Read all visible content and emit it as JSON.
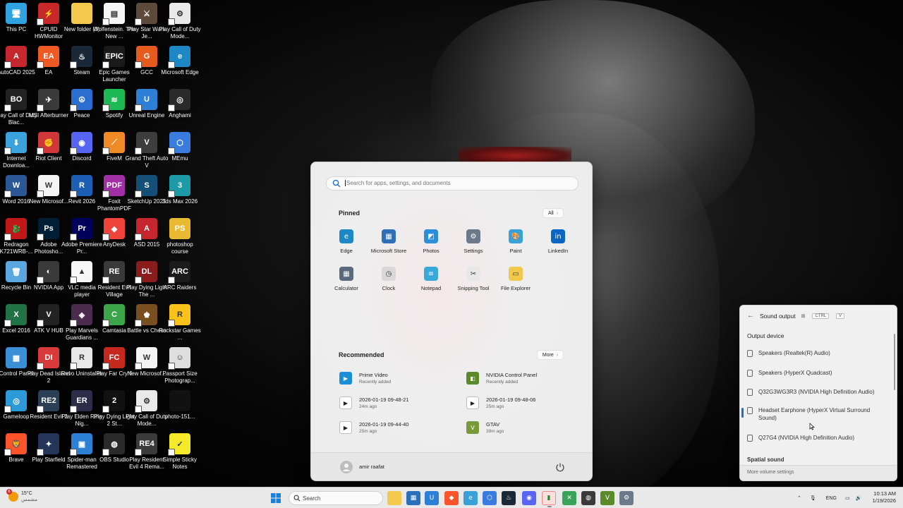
{
  "desktop": {
    "icons": [
      {
        "label": "This PC",
        "color": "#2ea3e0",
        "glyph": "🖥",
        "noarrow": true
      },
      {
        "label": "CPUID HWMonitor",
        "color": "#c62828",
        "glyph": "⚡"
      },
      {
        "label": "New folder (3)",
        "color": "#f2c94c",
        "glyph": "",
        "noarrow": true
      },
      {
        "label": "Wolfenstein. The New ...",
        "color": "#f5f5f5",
        "glyph": "▤"
      },
      {
        "label": "Play Star Wars Je...",
        "color": "#5d4a3a",
        "glyph": "⚔"
      },
      {
        "label": "Play Call of Duty Mode...",
        "color": "#e9e9e9",
        "glyph": "⚙"
      },
      {
        "label": "AutoCAD 2025",
        "color": "#c6262e",
        "glyph": "A"
      },
      {
        "label": "EA",
        "color": "#ef5a24",
        "glyph": "EA"
      },
      {
        "label": "Steam",
        "color": "#1b2838",
        "glyph": "♨"
      },
      {
        "label": "Epic Games Launcher",
        "color": "#1a1a1a",
        "glyph": "EPIC"
      },
      {
        "label": "GCC",
        "color": "#e65a1e",
        "glyph": "G"
      },
      {
        "label": "Microsoft Edge",
        "color": "#1e88c7",
        "glyph": "e"
      },
      {
        "label": "Play Call of Duty Blac...",
        "color": "#222",
        "glyph": "BO"
      },
      {
        "label": "MSI Afterburner",
        "color": "#3a3a3a",
        "glyph": "✈"
      },
      {
        "label": "Peace",
        "color": "#2a6fd0",
        "glyph": "☮"
      },
      {
        "label": "Spotify",
        "color": "#1db954",
        "glyph": "≋"
      },
      {
        "label": "Unreal Engine",
        "color": "#2e7fd6",
        "glyph": "U"
      },
      {
        "label": "Anghami",
        "color": "#2a2a2a",
        "glyph": "◎"
      },
      {
        "label": "Internet Downloa...",
        "color": "#3aa3de",
        "glyph": "⬇"
      },
      {
        "label": "Riot Client",
        "color": "#d13639",
        "glyph": "✊"
      },
      {
        "label": "Discord",
        "color": "#5865f2",
        "glyph": "◉"
      },
      {
        "label": "FiveM",
        "color": "#f08a24",
        "glyph": "⟋"
      },
      {
        "label": "Grand Theft Auto V",
        "color": "#3d3d3d",
        "glyph": "V"
      },
      {
        "label": "MEmu",
        "color": "#3a7be0",
        "glyph": "⬡"
      },
      {
        "label": "Word 2016",
        "color": "#2b5797",
        "glyph": "W"
      },
      {
        "label": "New Microsof...",
        "color": "#f4f4f4",
        "glyph": "W"
      },
      {
        "label": "Revit 2026",
        "color": "#1d5fb4",
        "glyph": "R"
      },
      {
        "label": "Foxit PhantomPDF",
        "color": "#a12fa5",
        "glyph": "PDF"
      },
      {
        "label": "SketchUp 2025",
        "color": "#134f77",
        "glyph": "S"
      },
      {
        "label": "3ds Max 2026",
        "color": "#1e9aa6",
        "glyph": "3"
      },
      {
        "label": "Redragon K721WRB-...",
        "color": "#c01818",
        "glyph": "🐉"
      },
      {
        "label": "Adobe Photosho...",
        "color": "#001e36",
        "glyph": "Ps"
      },
      {
        "label": "Adobe Premiere Pr...",
        "color": "#00005b",
        "glyph": "Pr"
      },
      {
        "label": "AnyDesk",
        "color": "#ef443b",
        "glyph": "◆"
      },
      {
        "label": "ASD 2015",
        "color": "#c6262e",
        "glyph": "A"
      },
      {
        "label": "photoshop course",
        "color": "#e8b931",
        "glyph": "PS",
        "noarrow": true
      },
      {
        "label": "Recycle Bin",
        "color": "#5aa6e0",
        "glyph": "🗑",
        "noarrow": true
      },
      {
        "label": "NVIDIA App",
        "color": "#3a3a3a",
        "glyph": "◐"
      },
      {
        "label": "VLC media player",
        "color": "#f6f6f6",
        "glyph": "▲"
      },
      {
        "label": "Resident Evil Village",
        "color": "#3a3a3a",
        "glyph": "RE"
      },
      {
        "label": "Play Dying Light The ...",
        "color": "#8a1c1c",
        "glyph": "DL"
      },
      {
        "label": "ARC Raiders",
        "color": "#1b1b1b",
        "glyph": "ARC"
      },
      {
        "label": "Excel 2016",
        "color": "#217346",
        "glyph": "X"
      },
      {
        "label": "ATK V HUB",
        "color": "#222",
        "glyph": "V"
      },
      {
        "label": "Play Marvels Guardians ...",
        "color": "#4b2c4f",
        "glyph": "◈"
      },
      {
        "label": "Camtasia",
        "color": "#3ca54a",
        "glyph": "C"
      },
      {
        "label": "Battle vs Chess",
        "color": "#7a4f1e",
        "glyph": "♚"
      },
      {
        "label": "Rockstar Games ...",
        "color": "#f9c21b",
        "glyph": "R"
      },
      {
        "label": "Control Panel",
        "color": "#3a8fd6",
        "glyph": "▦",
        "noarrow": true
      },
      {
        "label": "Play Dead Island 2",
        "color": "#d83a3a",
        "glyph": "DI"
      },
      {
        "label": "Revo Uninstaller",
        "color": "#e8e8e8",
        "glyph": "R"
      },
      {
        "label": "Play Far Cry 6",
        "color": "#c4281f",
        "glyph": "FC"
      },
      {
        "label": "New Microsof...",
        "color": "#f4f4f4",
        "glyph": "W"
      },
      {
        "label": "Passport Size Photograp...",
        "color": "#dedede",
        "glyph": "☺"
      },
      {
        "label": "Gameloop",
        "color": "#2c9ad8",
        "glyph": "◎"
      },
      {
        "label": "Resident Evil 2",
        "color": "#2b3f57",
        "glyph": "RE2"
      },
      {
        "label": "Play Elden Ring Nig...",
        "color": "#2d2d4a",
        "glyph": "ER"
      },
      {
        "label": "Play Dying Light 2 St...",
        "color": "#111",
        "glyph": "2"
      },
      {
        "label": "Play Call of Duty Mode...",
        "color": "#e9e9e9",
        "glyph": "⚙"
      },
      {
        "label": "photo-151...",
        "color": "#111",
        "glyph": "",
        "noarrow": true
      },
      {
        "label": "Brave",
        "color": "#fb542b",
        "glyph": "🦁"
      },
      {
        "label": "Play Starfield",
        "color": "#24355a",
        "glyph": "✦"
      },
      {
        "label": "Spider-man Remastered",
        "color": "#2e7fd6",
        "glyph": "▣"
      },
      {
        "label": "OBS Studio",
        "color": "#2a2a2a",
        "glyph": "◍"
      },
      {
        "label": "Play Resident Evil 4 Rema...",
        "color": "#3a3a3a",
        "glyph": "RE4"
      },
      {
        "label": "Simple Sticky Notes",
        "color": "#f4ea2a",
        "glyph": "✓"
      }
    ]
  },
  "start_menu": {
    "search_placeholder": "Search for apps, settings, and documents",
    "pinned_title": "Pinned",
    "all_label": "All",
    "pinned": [
      {
        "label": "Edge",
        "color": "#1e88c7",
        "glyph": "e"
      },
      {
        "label": "Microsoft Store",
        "color": "#2f6fb8",
        "glyph": "▦"
      },
      {
        "label": "Photos",
        "color": "#2a8fd8",
        "glyph": "◩"
      },
      {
        "label": "Settings",
        "color": "#6b7a8a",
        "glyph": "⚙"
      },
      {
        "label": "Paint",
        "color": "#3aa0d8",
        "glyph": "🎨"
      },
      {
        "label": "LinkedIn",
        "color": "#0a66c2",
        "glyph": "in"
      },
      {
        "label": "Calculator",
        "color": "#5a6a7a",
        "glyph": "▦"
      },
      {
        "label": "Clock",
        "color": "#d8d8d8",
        "glyph": "◷"
      },
      {
        "label": "Notepad",
        "color": "#3aa8d8",
        "glyph": "≡"
      },
      {
        "label": "Snipping Tool",
        "color": "#e8e8e8",
        "glyph": "✂"
      },
      {
        "label": "File Explorer",
        "color": "#f2c94c",
        "glyph": "▭"
      }
    ],
    "recommended_title": "Recommended",
    "more_label": "More",
    "recommended": [
      {
        "title": "Prime Video",
        "sub": "Recently added",
        "color": "#1a8fd6",
        "glyph": "▶"
      },
      {
        "title": "NVIDIA Control Panel",
        "sub": "Recently added",
        "color": "#5a8a2a",
        "glyph": "◧"
      },
      {
        "title": "2026-01-19 09-48-21",
        "sub": "24m ago",
        "color": "#fff",
        "glyph": "▶"
      },
      {
        "title": "2026-01-19 09-48-06",
        "sub": "25m ago",
        "color": "#fff",
        "glyph": "▶"
      },
      {
        "title": "2026-01-19 09-44-40",
        "sub": "25m ago",
        "color": "#fff",
        "glyph": "▶"
      },
      {
        "title": "GTAV",
        "sub": "39m ago",
        "color": "#7a9a3a",
        "glyph": "V"
      }
    ],
    "user_name": "amir raafat"
  },
  "sound_output": {
    "title": "Sound output",
    "shortcut_keys": [
      "CTRL",
      "V"
    ],
    "section_title": "Output device",
    "devices": [
      {
        "label": "Speakers (Realtek(R) Audio)",
        "active": false
      },
      {
        "label": "Speakers (HyperX Quadcast)",
        "active": false
      },
      {
        "label": "Q32G3WG3R3 (NVIDIA High Definition Audio)",
        "active": false
      },
      {
        "label": "Headset Earphone (HyperX Virtual Surround Sound)",
        "active": true
      },
      {
        "label": "Q27G4 (NVIDIA High Definition Audio)",
        "active": false
      }
    ],
    "spatial_title": "Spatial sound",
    "more_settings": "More volume settings"
  },
  "taskbar": {
    "weather_temp": "15°C",
    "weather_desc": "مشمس",
    "weather_badge": "6",
    "search_label": "Search",
    "language": "ENG",
    "time": "10:13 AM",
    "date": "1/19/2026",
    "accent": "#1a6fd6"
  }
}
